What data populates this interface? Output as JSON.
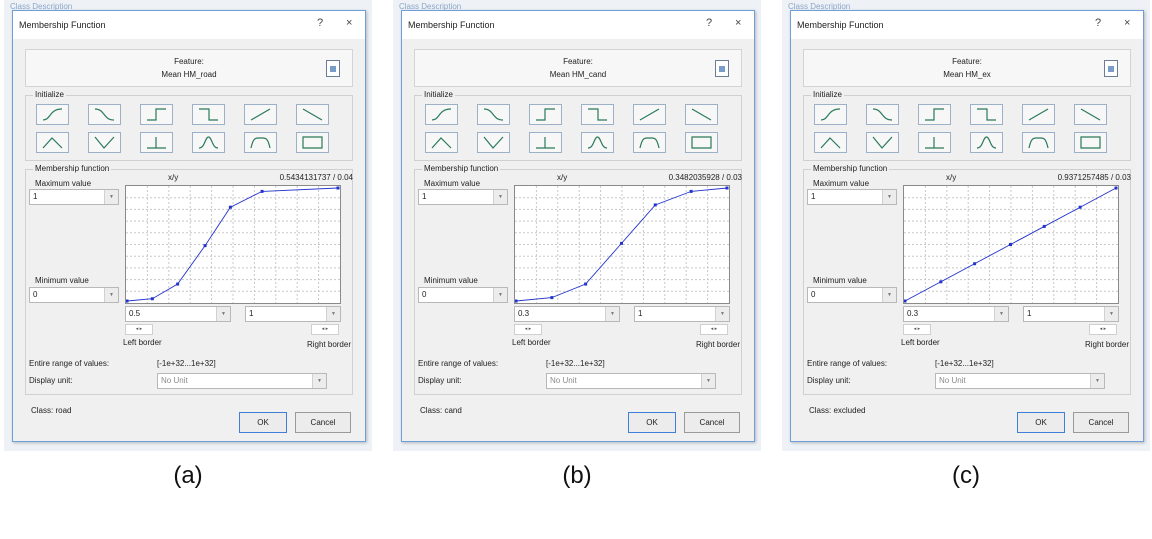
{
  "panels": [
    {
      "background_title": "Class Description",
      "title": "Membership Function",
      "help": "?",
      "close": "×",
      "feature_label": "Feature:",
      "feature_name": "Mean HM_road",
      "initialize_label": "Initialize",
      "membership_label": "Membership function",
      "xy_label": "x/y",
      "xy_value": "0.5434131737 / 0.04",
      "max_label": "Maximum value",
      "max_value": "1",
      "min_label": "Minimum value",
      "min_value": "0",
      "left_border_value": "0.5",
      "right_border_value": "1",
      "left_border_label": "Left border",
      "right_border_label": "Right border",
      "spinner_glyph": "◂ ▸",
      "range_label": "Entire range of values:",
      "range_value": "[-1e+32...1e+32]",
      "unit_label": "Display unit:",
      "unit_value": "No Unit",
      "class_text": "Class: road",
      "ok": "OK",
      "cancel": "Cancel",
      "caption": "(a)",
      "points": [
        [
          0,
          0
        ],
        [
          0.12,
          0.02
        ],
        [
          0.24,
          0.15
        ],
        [
          0.37,
          0.49
        ],
        [
          0.49,
          0.83
        ],
        [
          0.64,
          0.97
        ],
        [
          1,
          1
        ]
      ]
    },
    {
      "background_title": "Class Description",
      "title": "Membership Function",
      "help": "?",
      "close": "×",
      "feature_label": "Feature:",
      "feature_name": "Mean HM_cand",
      "initialize_label": "Initialize",
      "membership_label": "Membership function",
      "xy_label": "x/y",
      "xy_value": "0.3482035928 / 0.03",
      "max_label": "Maximum value",
      "max_value": "1",
      "min_label": "Minimum value",
      "min_value": "0",
      "left_border_value": "0.3",
      "right_border_value": "1",
      "left_border_label": "Left border",
      "right_border_label": "Right border",
      "spinner_glyph": "◂ ▸",
      "range_label": "Entire range of values:",
      "range_value": "[-1e+32...1e+32]",
      "unit_label": "Display unit:",
      "unit_value": "No Unit",
      "class_text": "Class: cand",
      "ok": "OK",
      "cancel": "Cancel",
      "caption": "(b)",
      "points": [
        [
          0,
          0
        ],
        [
          0.17,
          0.03
        ],
        [
          0.33,
          0.15
        ],
        [
          0.5,
          0.51
        ],
        [
          0.66,
          0.85
        ],
        [
          0.83,
          0.97
        ],
        [
          1,
          1
        ]
      ]
    },
    {
      "background_title": "Class Description",
      "title": "Membership Function",
      "help": "?",
      "close": "×",
      "feature_label": "Feature:",
      "feature_name": "Mean HM_ex",
      "initialize_label": "Initialize",
      "membership_label": "Membership function",
      "xy_label": "x/y",
      "xy_value": "0.9371257485 / 0.03",
      "max_label": "Maximum value",
      "max_value": "1",
      "min_label": "Minimum value",
      "min_value": "0",
      "left_border_value": "0.3",
      "right_border_value": "1",
      "left_border_label": "Left border",
      "right_border_label": "Right border",
      "spinner_glyph": "◂ ▸",
      "range_label": "Entire range of values:",
      "range_value": "[-1e+32...1e+32]",
      "unit_label": "Display unit:",
      "unit_value": "No Unit",
      "class_text": "Class: excluded",
      "ok": "OK",
      "cancel": "Cancel",
      "caption": "(c)",
      "points": [
        [
          0,
          0
        ],
        [
          0.17,
          0.17
        ],
        [
          0.33,
          0.33
        ],
        [
          0.5,
          0.5
        ],
        [
          0.66,
          0.66
        ],
        [
          0.83,
          0.83
        ],
        [
          1,
          1
        ]
      ]
    }
  ],
  "init_icons": [
    "s-curve-up-icon",
    "s-curve-down-icon",
    "step-up-icon",
    "step-down-icon",
    "linear-up-icon",
    "linear-down-icon",
    "triangle-icon",
    "v-shape-icon",
    "singleton-icon",
    "bell-icon",
    "trapezoid-icon",
    "full-range-icon"
  ],
  "colors": {
    "dialog_border": "#6f9fd8",
    "curve": "#2233cc",
    "grid": "#c8c8c8"
  }
}
